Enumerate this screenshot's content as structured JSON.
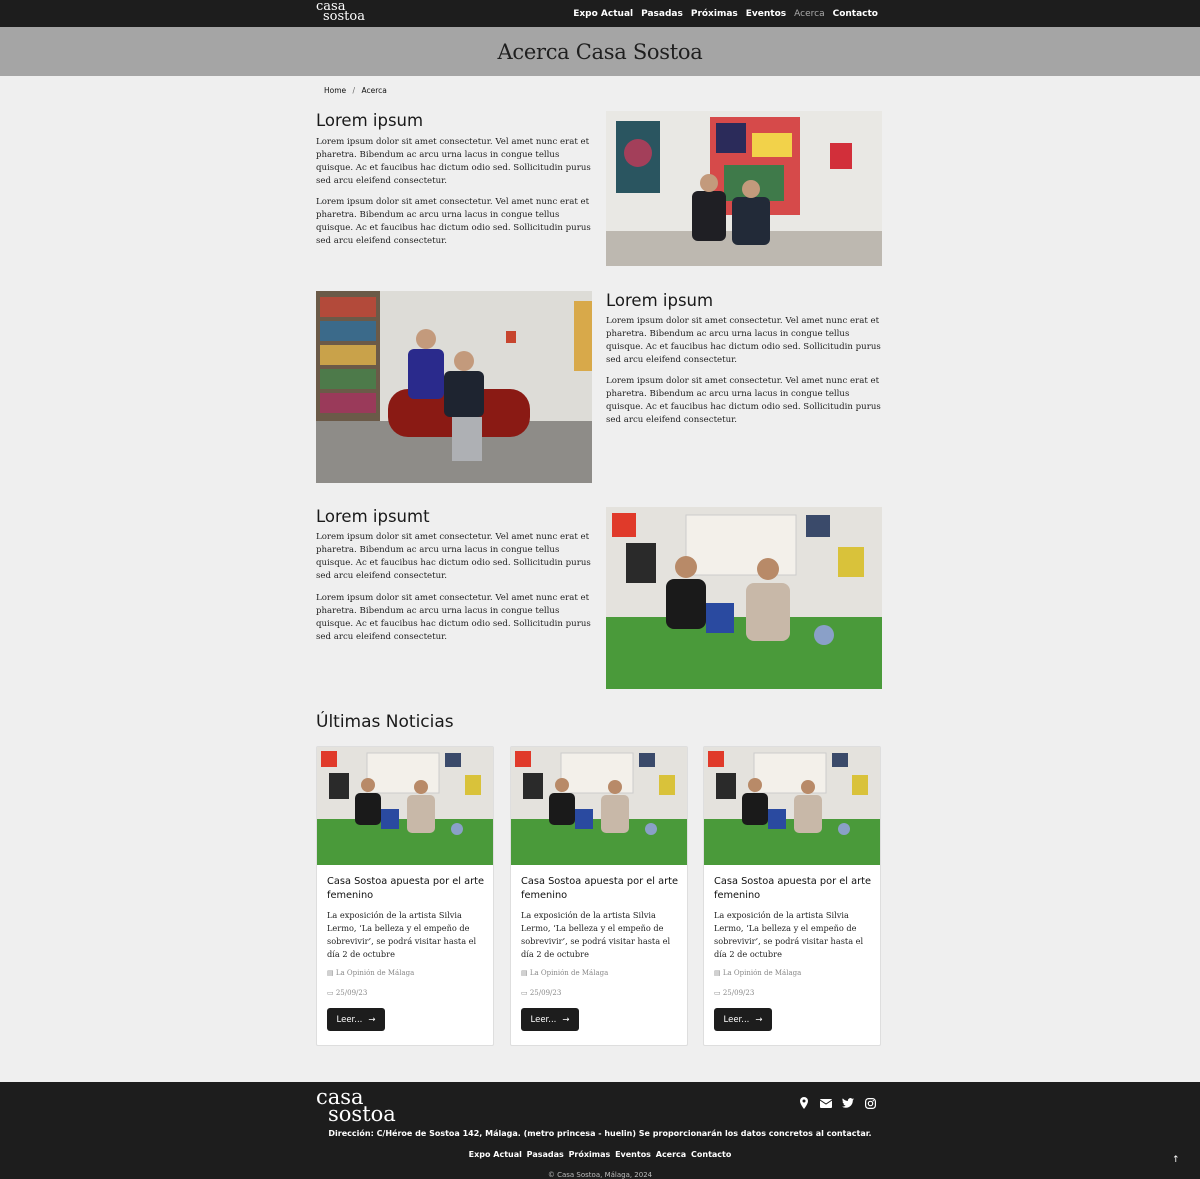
{
  "brand": {
    "logo_line1": "casa",
    "logo_line2": "sostoa"
  },
  "nav": {
    "items": [
      {
        "label": "Expo Actual"
      },
      {
        "label": "Pasadas"
      },
      {
        "label": "Próximas"
      },
      {
        "label": "Eventos"
      },
      {
        "label": "Acerca"
      },
      {
        "label": "Contacto"
      }
    ],
    "active": "Acerca"
  },
  "hero": {
    "title": "Acerca Casa Sostoa"
  },
  "breadcrumb": {
    "home": "Home",
    "separator": "/",
    "current": "Acerca"
  },
  "sections": [
    {
      "title": "Lorem ipsum",
      "p1": "Lorem ipsum dolor sit amet consectetur. Vel amet nunc erat et pharetra. Bibendum ac arcu urna lacus in congue tellus quisque. Ac et faucibus hac dictum odio sed. Sollicitudin purus sed arcu eleifend consectetur.",
      "p2": "Lorem ipsum dolor sit amet consectetur. Vel amet nunc erat et pharetra. Bibendum ac arcu urna lacus in congue tellus quisque. Ac et faucibus hac dictum odio sed. Sollicitudin purus sed arcu eleifend consectetur."
    },
    {
      "title": "Lorem ipsum",
      "p1": "Lorem ipsum dolor sit amet consectetur. Vel amet nunc erat et pharetra. Bibendum ac arcu urna lacus in congue tellus quisque. Ac et faucibus hac dictum odio sed. Sollicitudin purus sed arcu eleifend consectetur.",
      "p2": "Lorem ipsum dolor sit amet consectetur. Vel amet nunc erat et pharetra. Bibendum ac arcu urna lacus in congue tellus quisque. Ac et faucibus hac dictum odio sed. Sollicitudin purus sed arcu eleifend consectetur."
    },
    {
      "title": "Lorem ipsumt",
      "p1": "Lorem ipsum dolor sit amet consectetur. Vel amet nunc erat et pharetra. Bibendum ac arcu urna lacus in congue tellus quisque. Ac et faucibus hac dictum odio sed. Sollicitudin purus sed arcu eleifend consectetur.",
      "p2": "Lorem ipsum dolor sit amet consectetur. Vel amet nunc erat et pharetra. Bibendum ac arcu urna lacus in congue tellus quisque. Ac et faucibus hac dictum odio sed. Sollicitudin purus sed arcu eleifend consectetur."
    }
  ],
  "news": {
    "heading": "Últimas Noticias",
    "cards": [
      {
        "title": "Casa Sostoa apuesta por el arte femenino",
        "desc": "La exposición de la artista Silvia Lermo, ‘La belleza y el empeño de sobrevivir’, se podrá visitar hasta el día 2 de octubre",
        "source": "La Opinión de Málaga",
        "date": "25/09/23",
        "button": "Leer..."
      },
      {
        "title": "Casa Sostoa apuesta por el arte femenino",
        "desc": "La exposición de la artista Silvia Lermo, ‘La belleza y el empeño de sobrevivir’, se podrá visitar hasta el día 2 de octubre",
        "source": "La Opinión de Málaga",
        "date": "25/09/23",
        "button": "Leer..."
      },
      {
        "title": "Casa Sostoa apuesta por el arte femenino",
        "desc": "La exposición de la artista Silvia Lermo, ‘La belleza y el empeño de sobrevivir’, se podrá visitar hasta el día 2 de octubre",
        "source": "La Opinión de Málaga",
        "date": "25/09/23",
        "button": "Leer..."
      }
    ]
  },
  "footer": {
    "address": "Dirección: C/Héroe de Sostoa 142, Málaga. (metro princesa - huelin) Se proporcionarán los datos concretos al contactar.",
    "links": [
      "Expo Actual",
      "Pasadas",
      "Próximas",
      "Eventos",
      "Acerca",
      "Contacto"
    ],
    "copyright": "© Casa Sostoa, Málaga, 2024",
    "icons": [
      "map-pin-icon",
      "envelope-icon",
      "twitter-icon",
      "instagram-icon"
    ],
    "to_top": "↑"
  }
}
